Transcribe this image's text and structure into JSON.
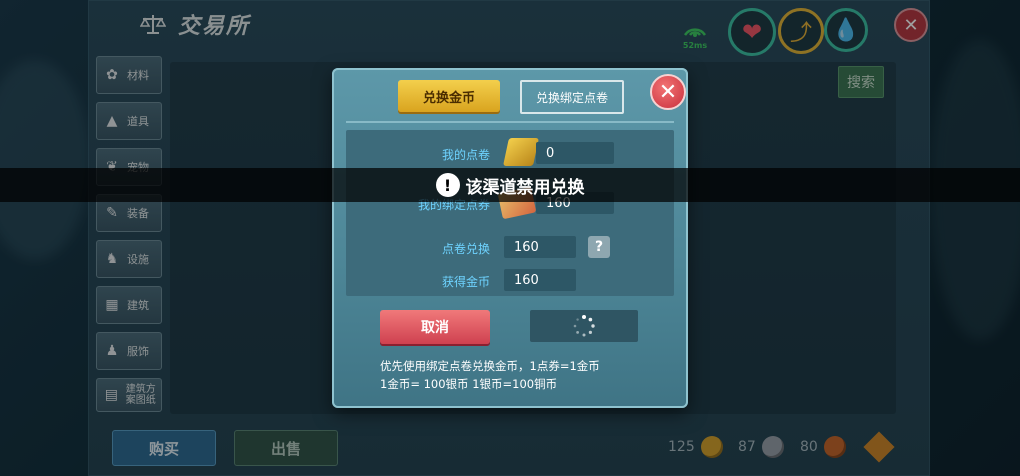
{
  "screen": {
    "title": "交易所",
    "ping": "52ms",
    "colors": {
      "accent_gold": "#e8b93a",
      "cancel_red": "#d9505d",
      "label_cyan": "#6ed3ff"
    }
  },
  "sidebar": {
    "items": [
      {
        "label": "材料",
        "icon": "materials-icon"
      },
      {
        "label": "道具",
        "icon": "item-icon"
      },
      {
        "label": "宠物",
        "icon": "pet-paw-icon"
      },
      {
        "label": "装备",
        "icon": "equipment-icon"
      },
      {
        "label": "设施",
        "icon": "facility-icon"
      },
      {
        "label": "建筑",
        "icon": "building-icon"
      },
      {
        "label": "服饰",
        "icon": "clothing-icon"
      },
      {
        "label": "建筑方案图纸",
        "icon": "blueprint-icon"
      }
    ]
  },
  "toolbar": {
    "search_label": "搜索"
  },
  "bottom": {
    "buy_label": "购买",
    "sell_label": "出售",
    "gold_amount": "125",
    "silver_amount": "87",
    "copper_amount": "80"
  },
  "dialog": {
    "tab_gold": "兑换金币",
    "tab_bound": "兑换绑定点卷",
    "my_points_label": "我的点卷",
    "my_points_value": "0",
    "my_bound_label": "我的绑定点券",
    "my_bound_value": "160",
    "exchange_label": "点卷兑换",
    "exchange_value": "160",
    "obtain_label": "获得金币",
    "obtain_value": "160",
    "help_symbol": "?",
    "cancel_label": "取消",
    "note_line1": "优先使用绑定点卷兑换金币，1点券=1金币",
    "note_line2": "1金币= 100银币  1银币=100铜币"
  },
  "toast": {
    "message": "该渠道禁用兑换",
    "icon_text": "!"
  }
}
